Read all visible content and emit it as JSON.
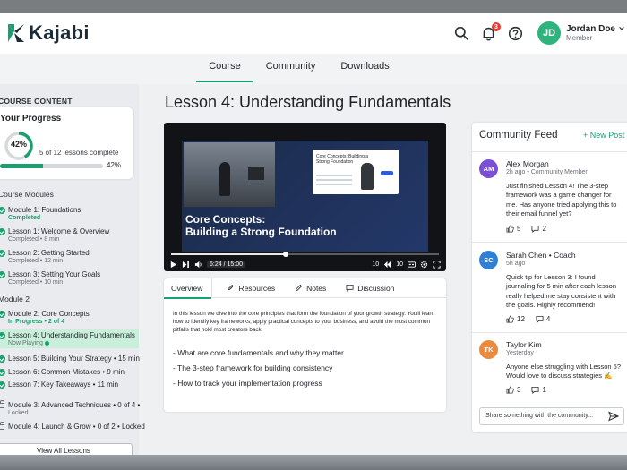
{
  "app": {
    "name": "Kajabi"
  },
  "user": {
    "name": "Jordan Doe",
    "role": "Member",
    "initials": "JD",
    "notifications": "3"
  },
  "nav": {
    "tabs": [
      {
        "label": "Course"
      },
      {
        "label": "Community"
      },
      {
        "label": "Downloads"
      }
    ]
  },
  "sidebar": {
    "heading": "COURSE CONTENT",
    "progress": {
      "title": "Your Progress",
      "percent_label": "42%",
      "percent": 42,
      "count_text": "5 of 12 lessons complete",
      "bar_label": "42%"
    },
    "section_modules": "Course Modules",
    "section_module2": "Module 2",
    "items": [
      {
        "title": "Module 1: Foundations",
        "sub": "Completed"
      },
      {
        "title": "Lesson 1: Welcome & Overview",
        "sub": "Completed • 8 min"
      },
      {
        "title": "Lesson 2: Getting Started",
        "sub": "Completed • 12 min"
      },
      {
        "title": "Lesson 3: Setting Your Goals",
        "sub": "Completed • 10 min"
      },
      {
        "title": "Module 2: Core Concepts",
        "sub": "In Progress • 2 of 4"
      },
      {
        "title": "Lesson 4: Understanding Fundamentals",
        "sub": "Now Playing"
      },
      {
        "title": "Lesson 5: Building Your Strategy • 15 min"
      },
      {
        "title": "Lesson 6: Common Mistakes • 9 min"
      },
      {
        "title": "Lesson 7: Key Takeaways • 11 min"
      },
      {
        "title": "Module 3: Advanced Techniques • 0 of 4 •",
        "sub": "Locked"
      },
      {
        "title": "Module 4: Launch & Grow • 0 of 2 • Locked"
      }
    ],
    "view_all": "View All Lessons"
  },
  "lesson": {
    "title": "Lesson 4: Understanding Fundamentals",
    "video": {
      "slide_title_line1": "Core Concepts:",
      "slide_title_line2": "Building a Strong Foundation",
      "card_title": "Core Concepts: Building a Strong Foundation",
      "time": "6:24 / 15:00",
      "progress": 0.427,
      "skip_back": "10",
      "skip_fwd": "10"
    },
    "tabs": [
      {
        "label": "Overview"
      },
      {
        "label": "Resources"
      },
      {
        "label": "Notes"
      },
      {
        "label": "Discussion"
      }
    ],
    "overview_text": "In this lesson we dive into the core principles that form the foundation of your growth strategy. You'll learn how to identify key frameworks, apply practical concepts to your business, and avoid the most common pitfalls that hold most creators back.",
    "bullets": [
      "- What are core fundamentals and why they matter",
      "- The 3-step framework for building consistency",
      "- How to track your implementation progress"
    ]
  },
  "feed": {
    "title": "Community Feed",
    "new_post": "+ New Post",
    "posts": [
      {
        "initials": "AM",
        "color": "#7b4fd6",
        "name": "Alex Morgan",
        "meta": "2h ago • Community Member",
        "text": "Just finished Lesson 4! The 3-step framework was a game changer for me. Has anyone tried applying this to their email funnel yet?",
        "likes": "5",
        "comments": "2"
      },
      {
        "initials": "SC",
        "color": "#2f7fd4",
        "name": "Sarah Chen • Coach",
        "meta": "5h ago",
        "text": "Quick tip for Lesson 3: I found journaling for 5 min after each lesson really helped me stay consistent with the goals. Highly recommend!",
        "likes": "12",
        "comments": "4"
      },
      {
        "initials": "TK",
        "color": "#e98a3e",
        "name": "Taylor Kim",
        "meta": "Yesterday",
        "text": "Anyone else struggling with Lesson 5? Would love to discuss strategies ✍️",
        "likes": "3",
        "comments": "1"
      }
    ],
    "compose_placeholder": "Share something with the community..."
  },
  "colors": {
    "accent": "#1aa06e",
    "brand_dark": "#1d2b36"
  }
}
